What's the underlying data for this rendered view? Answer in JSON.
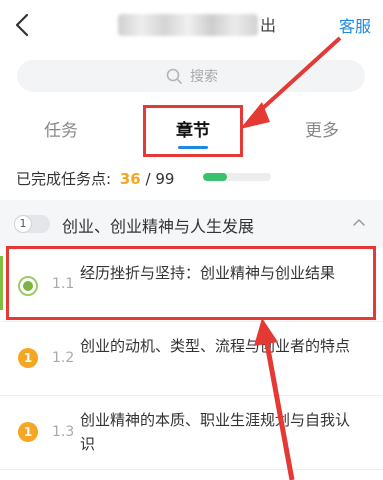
{
  "header": {
    "title_visible_tail": "出",
    "service_label": "客服"
  },
  "search": {
    "placeholder": "搜索"
  },
  "tabs": [
    {
      "label": "任务",
      "active": false
    },
    {
      "label": "章节",
      "active": true
    },
    {
      "label": "更多",
      "active": false
    }
  ],
  "progress": {
    "label": "已完成任务点:",
    "done": "36",
    "total": "/ 99",
    "fraction": 0.36
  },
  "chapter": {
    "number": "1",
    "title": "创业、创业精神与人生发展"
  },
  "lessons": [
    {
      "number": "1.1",
      "title": "经历挫折与坚持：创业精神与创业结果",
      "status": "current"
    },
    {
      "number": "1.2",
      "title": "创业的动机、类型、流程与创业者的特点",
      "status": "pending",
      "badge": "1"
    },
    {
      "number": "1.3",
      "title": "创业精神的本质、职业生涯规划与自我认识",
      "status": "pending",
      "badge": "1"
    }
  ],
  "colors": {
    "accent": "#1e88e5",
    "annotation": "#e53935",
    "progress": "#39c16c",
    "warning": "#f5a623"
  }
}
